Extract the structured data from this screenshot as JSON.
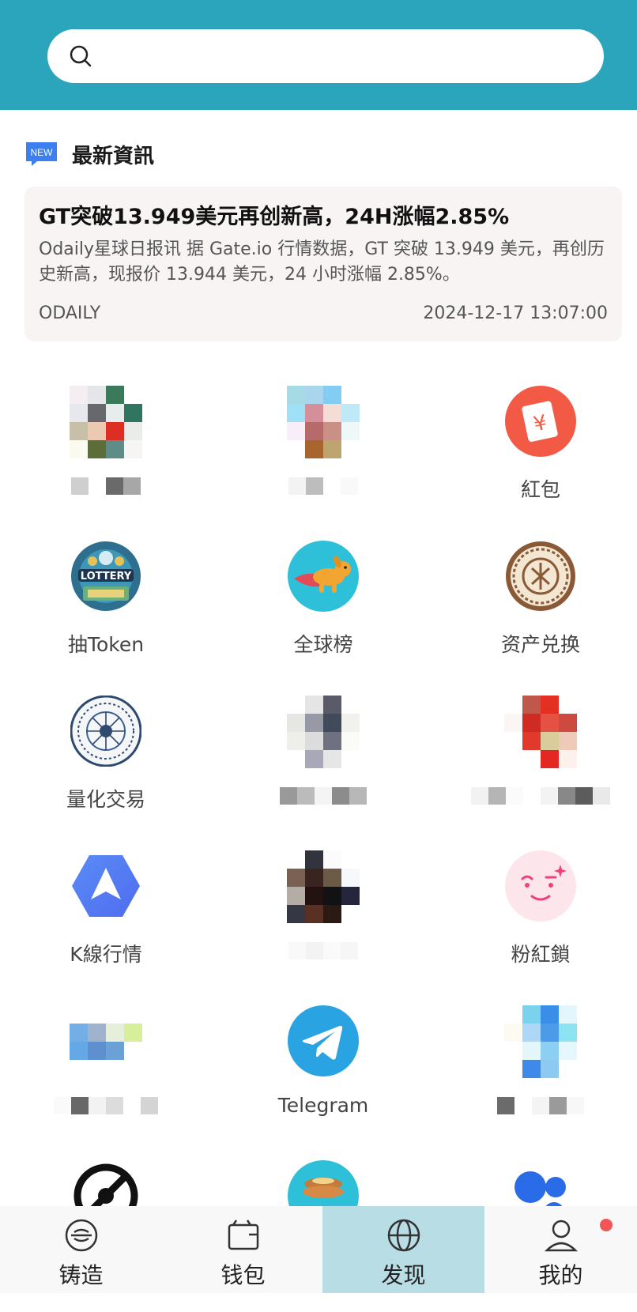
{
  "search": {
    "placeholder": ""
  },
  "news": {
    "badge": "NEW",
    "section_title": "最新資訊",
    "headline": "GT突破13.949美元再创新高，24H涨幅2.85%",
    "summary": "Odaily星球日报讯 据 Gate.io 行情数据，GT 突破 13.949 美元，再创历史新高，现报价 13.944 美元，24 小时涨幅 2.85%。",
    "source": "ODAILY",
    "time": "2024-12-17 13:07:00"
  },
  "apps": [
    {
      "label": "",
      "icon": "pixelated-app-icon"
    },
    {
      "label": "",
      "icon": "pixelated-app-icon"
    },
    {
      "label": "紅包",
      "icon": "red-envelope-icon"
    },
    {
      "label": "抽Token",
      "icon": "lottery-icon"
    },
    {
      "label": "全球榜",
      "icon": "flying-dog-icon"
    },
    {
      "label": "资产兑换",
      "icon": "coin-seal-icon"
    },
    {
      "label": "量化交易",
      "icon": "quant-circuit-icon"
    },
    {
      "label": "",
      "icon": "pixelated-app-icon"
    },
    {
      "label": "",
      "icon": "pixelated-app-icon"
    },
    {
      "label": "K線行情",
      "icon": "kline-arrow-icon"
    },
    {
      "label": "",
      "icon": "pixelated-app-icon"
    },
    {
      "label": "粉紅鎖",
      "icon": "pink-face-icon"
    },
    {
      "label": "",
      "icon": "pixelated-app-icon"
    },
    {
      "label": "Telegram",
      "icon": "telegram-icon"
    },
    {
      "label": "",
      "icon": "pixelated-app-icon"
    },
    {
      "label": "",
      "icon": "partial-icon"
    },
    {
      "label": "",
      "icon": "pancake-icon"
    },
    {
      "label": "",
      "icon": "blue-dots-icon"
    }
  ],
  "tabs": [
    {
      "label": "铸造",
      "icon": "mint-icon"
    },
    {
      "label": "钱包",
      "icon": "wallet-icon"
    },
    {
      "label": "发现",
      "icon": "globe-icon",
      "active": true
    },
    {
      "label": "我的",
      "icon": "user-icon",
      "badge_dot": true
    }
  ],
  "colors": {
    "header": "#2ba5bb",
    "active_tab": "#b8dde5",
    "badge_dot": "#f05656"
  }
}
